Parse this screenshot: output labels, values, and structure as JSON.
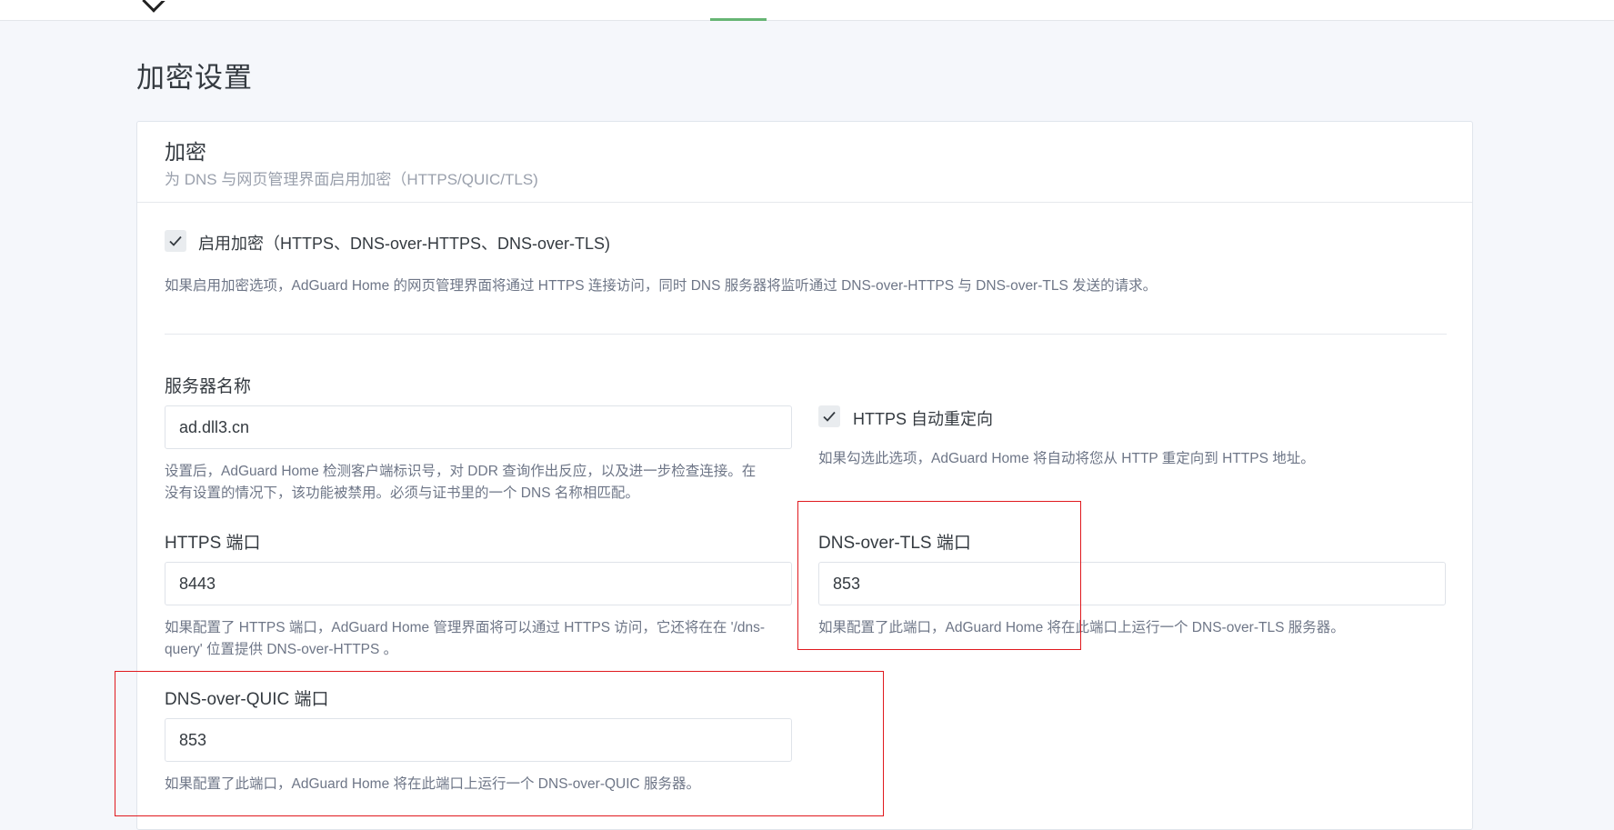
{
  "page": {
    "title": "加密设置"
  },
  "card": {
    "title": "加密",
    "subtitle": "为 DNS 与网页管理界面启用加密（HTTPS/QUIC/TLS)"
  },
  "enable_encryption": {
    "label": "启用加密（HTTPS、DNS-over-HTTPS、DNS-over-TLS)",
    "checked": true,
    "help": "如果启用加密选项，AdGuard Home 的网页管理界面将通过 HTTPS 连接访问，同时 DNS 服务器将监听通过 DNS-over-HTTPS 与 DNS-over-TLS 发送的请求。"
  },
  "server_name": {
    "label": "服务器名称",
    "value": "ad.dll3.cn",
    "help_line1": "设置后，AdGuard Home 检测客户端标识号，对 DDR 查询作出反应，以及进一步检查连接。在",
    "help_line2": "没有设置的情况下，该功能被禁用。必须与证书里的一个 DNS 名称相匹配。"
  },
  "https_redirect": {
    "label": "HTTPS 自动重定向",
    "checked": true,
    "help": "如果勾选此选项，AdGuard Home 将自动将您从 HTTP 重定向到 HTTPS 地址。"
  },
  "https_port": {
    "label": "HTTPS 端口",
    "value": "8443",
    "help_line1": "如果配置了 HTTPS 端口，AdGuard Home 管理界面将可以通过 HTTPS 访问，它还将在在 '/dns-",
    "help_line2": "query' 位置提供 DNS-over-HTTPS 。"
  },
  "dot_port": {
    "label": "DNS-over-TLS 端口",
    "value": "853",
    "help": "如果配置了此端口，AdGuard Home 将在此端口上运行一个 DNS-over-TLS 服务器。"
  },
  "doq_port": {
    "label": "DNS-over-QUIC 端口",
    "value": "853",
    "help": "如果配置了此端口，AdGuard Home 将在此端口上运行一个 DNS-over-QUIC 服务器。"
  },
  "icons": {
    "checkbox_mark": "check-icon"
  },
  "colors": {
    "accent_green": "#66b574",
    "highlight_red": "#e0191e"
  }
}
